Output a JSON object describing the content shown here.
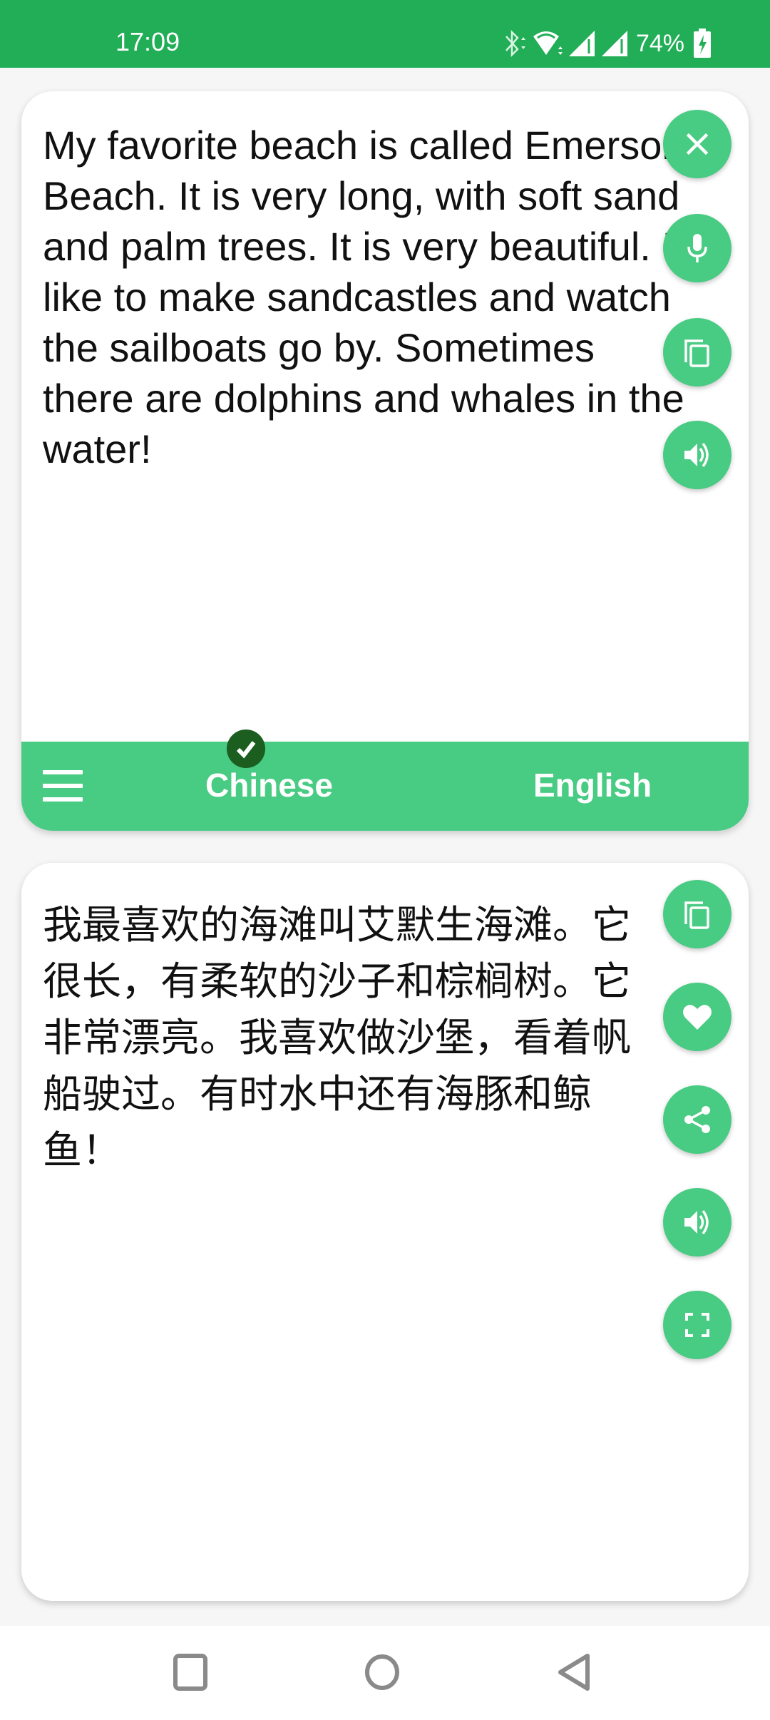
{
  "status_bar": {
    "time": "17:09",
    "battery": "74%",
    "icons": [
      "bluetooth-icon",
      "wifi-icon",
      "signal-icon",
      "signal-icon",
      "battery-charging-icon"
    ]
  },
  "source_panel": {
    "text": "My favorite beach is called Emerson Beach. It is very long, with soft sand and palm trees. It is very beautiful. I like to make sandcastles and watch the sailboats go by. Sometimes there are dolphins and whales in the water!",
    "actions": [
      {
        "name": "clear",
        "icon": "close-icon"
      },
      {
        "name": "voice-input",
        "icon": "microphone-icon"
      },
      {
        "name": "copy",
        "icon": "copy-icon"
      },
      {
        "name": "speak",
        "icon": "speaker-icon"
      }
    ]
  },
  "language_bar": {
    "menu_icon": "hamburger-menu-icon",
    "source_language": "Chinese",
    "target_language": "English",
    "selected_indicator": "checkmark-icon"
  },
  "target_panel": {
    "text": "我最喜欢的海滩叫艾默生海滩。它很长，有柔软的沙子和棕榈树。它非常漂亮。我喜欢做沙堡，看着帆船驶过。有时水中还有海豚和鲸鱼！",
    "actions": [
      {
        "name": "copy",
        "icon": "copy-icon"
      },
      {
        "name": "favorite",
        "icon": "heart-icon"
      },
      {
        "name": "share",
        "icon": "share-icon"
      },
      {
        "name": "speak",
        "icon": "speaker-icon"
      },
      {
        "name": "fullscreen",
        "icon": "fullscreen-icon"
      }
    ]
  },
  "navigation_bar": {
    "buttons": [
      "recents",
      "home",
      "back"
    ]
  },
  "colors": {
    "status_bar": "#21ae57",
    "accent": "#48cb82",
    "check_badge": "#1b5e20",
    "background": "#f6f6f6"
  }
}
